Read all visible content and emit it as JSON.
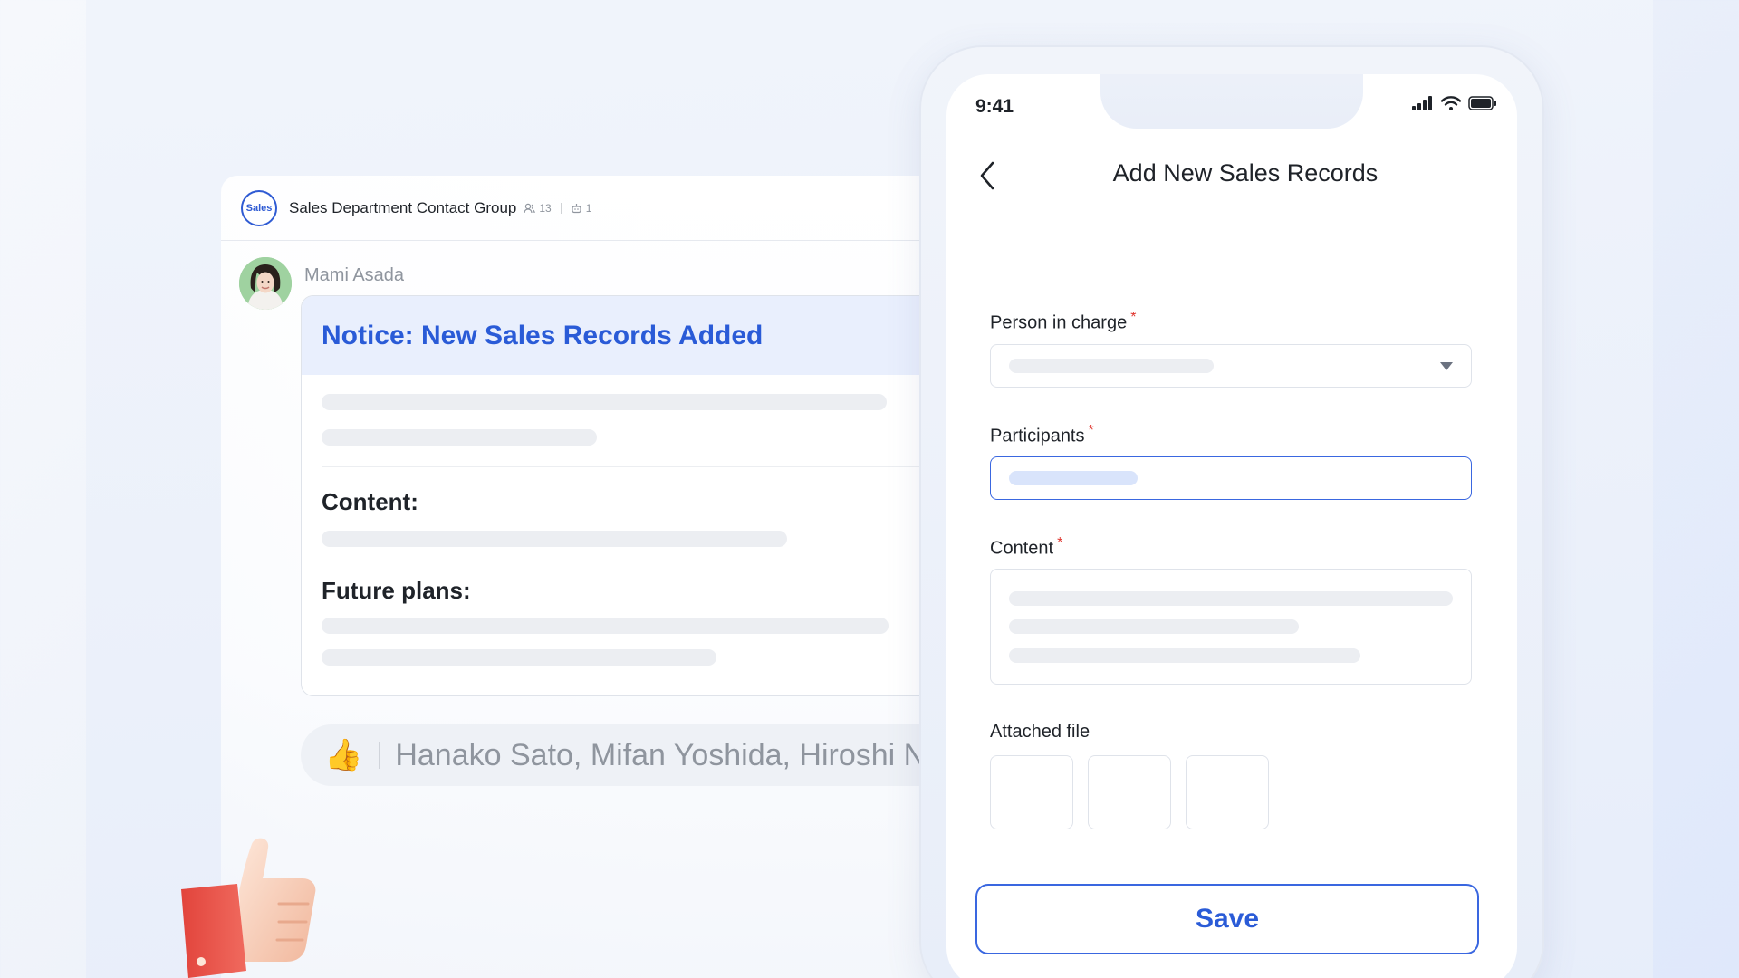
{
  "chat": {
    "group": {
      "avatar_text": "Sales",
      "name": "Sales Department Contact Group",
      "member_count": "13",
      "bot_count": "1"
    },
    "sender": {
      "name": "Mami Asada"
    },
    "message": {
      "title": "Notice: New Sales Records Added",
      "section_content": "Content:",
      "section_future": "Future plans:"
    },
    "reaction": {
      "emoji": "👍",
      "names": "Hanako Sato, Mifan Yoshida, Hiroshi N"
    }
  },
  "phone": {
    "status": {
      "time": "9:41"
    },
    "nav": {
      "title": "Add New Sales Records"
    },
    "form": {
      "person_in_charge_label": "Person in charge",
      "participants_label": "Participants",
      "content_label": "Content",
      "attached_file_label": "Attached file",
      "required_mark": "*"
    },
    "save_label": "Save"
  },
  "colors": {
    "accent": "#2a5bd7",
    "required": "#e0342d",
    "header_tint": "#e9effd"
  }
}
